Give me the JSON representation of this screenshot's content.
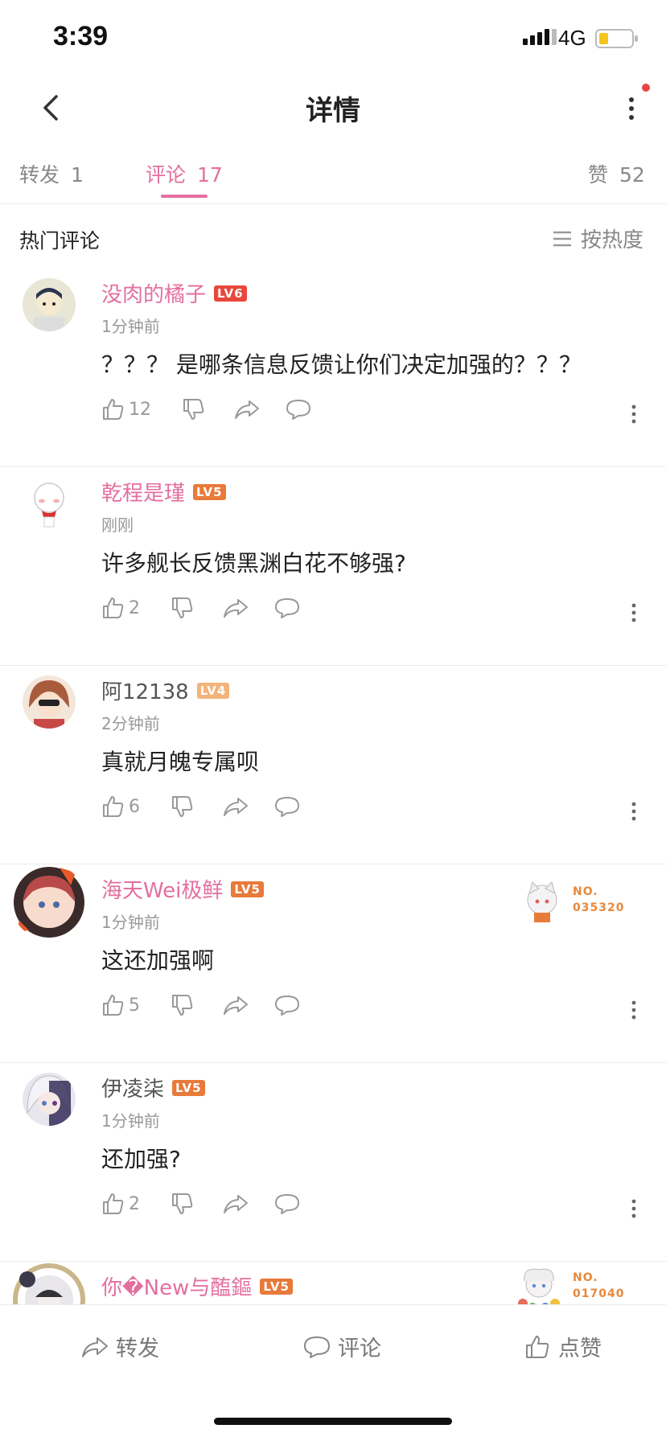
{
  "status_bar": {
    "time": "3:39",
    "network": "4G",
    "battery_level": 0.3
  },
  "nav": {
    "title": "详情"
  },
  "tabs": [
    {
      "label": "转发",
      "count": "1",
      "active": false
    },
    {
      "label": "评论",
      "count": "17",
      "active": true
    },
    {
      "label": "赞",
      "count": "52",
      "active": false
    }
  ],
  "section": {
    "title": "热门评论",
    "sort_label": "按热度"
  },
  "comments": [
    {
      "username": "没肉的橘子",
      "level": "LV6",
      "time": "1分钟前",
      "text": "？？？ 是哪条信息反馈让你们决定加强的？？？",
      "likes": "12"
    },
    {
      "username": "乾程是瑾",
      "level": "LV5",
      "time": "刚刚",
      "text": "许多舰长反馈黑渊白花不够强?",
      "likes": "2"
    },
    {
      "username": "阿12138",
      "level": "LV4",
      "time": "2分钟前",
      "text": "真就月魄专属呗",
      "likes": "6"
    },
    {
      "username": "海天Wei极鲜",
      "level": "LV5",
      "time": "1分钟前",
      "text": "这还加强啊",
      "likes": "5",
      "badge_no": "NO.",
      "badge_id": "035320"
    },
    {
      "username": "伊凌柒",
      "level": "LV5",
      "time": "1分钟前",
      "text": "还加强?",
      "likes": "2"
    },
    {
      "username": "你�New与醢鏂",
      "level": "LV5",
      "badge_no": "NO.",
      "badge_id": "017040"
    }
  ],
  "bottom_bar": {
    "forward": "转发",
    "comment": "评论",
    "like": "点赞"
  },
  "colors": {
    "accent": "#e46f9e",
    "lv6": "#e8473b",
    "lv5": "#e87a3a",
    "lv4": "#f3b37a"
  }
}
